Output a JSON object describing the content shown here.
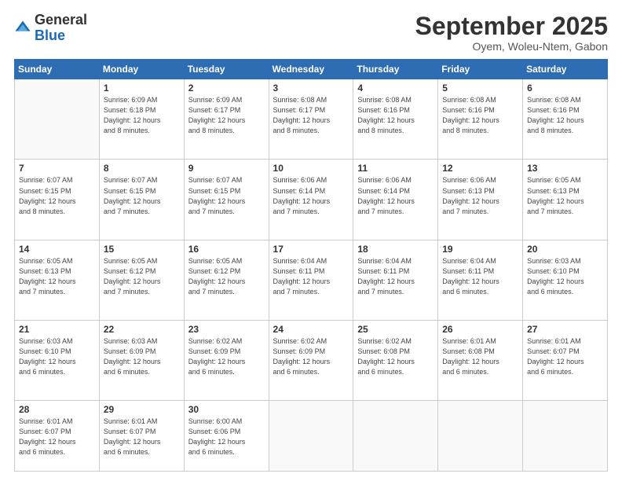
{
  "header": {
    "logo_general": "General",
    "logo_blue": "Blue",
    "month": "September 2025",
    "location": "Oyem, Woleu-Ntem, Gabon"
  },
  "weekdays": [
    "Sunday",
    "Monday",
    "Tuesday",
    "Wednesday",
    "Thursday",
    "Friday",
    "Saturday"
  ],
  "weeks": [
    [
      {
        "day": "",
        "info": ""
      },
      {
        "day": "1",
        "info": "Sunrise: 6:09 AM\nSunset: 6:18 PM\nDaylight: 12 hours\nand 8 minutes."
      },
      {
        "day": "2",
        "info": "Sunrise: 6:09 AM\nSunset: 6:17 PM\nDaylight: 12 hours\nand 8 minutes."
      },
      {
        "day": "3",
        "info": "Sunrise: 6:08 AM\nSunset: 6:17 PM\nDaylight: 12 hours\nand 8 minutes."
      },
      {
        "day": "4",
        "info": "Sunrise: 6:08 AM\nSunset: 6:16 PM\nDaylight: 12 hours\nand 8 minutes."
      },
      {
        "day": "5",
        "info": "Sunrise: 6:08 AM\nSunset: 6:16 PM\nDaylight: 12 hours\nand 8 minutes."
      },
      {
        "day": "6",
        "info": "Sunrise: 6:08 AM\nSunset: 6:16 PM\nDaylight: 12 hours\nand 8 minutes."
      }
    ],
    [
      {
        "day": "7",
        "info": "Sunrise: 6:07 AM\nSunset: 6:15 PM\nDaylight: 12 hours\nand 8 minutes."
      },
      {
        "day": "8",
        "info": "Sunrise: 6:07 AM\nSunset: 6:15 PM\nDaylight: 12 hours\nand 7 minutes."
      },
      {
        "day": "9",
        "info": "Sunrise: 6:07 AM\nSunset: 6:15 PM\nDaylight: 12 hours\nand 7 minutes."
      },
      {
        "day": "10",
        "info": "Sunrise: 6:06 AM\nSunset: 6:14 PM\nDaylight: 12 hours\nand 7 minutes."
      },
      {
        "day": "11",
        "info": "Sunrise: 6:06 AM\nSunset: 6:14 PM\nDaylight: 12 hours\nand 7 minutes."
      },
      {
        "day": "12",
        "info": "Sunrise: 6:06 AM\nSunset: 6:13 PM\nDaylight: 12 hours\nand 7 minutes."
      },
      {
        "day": "13",
        "info": "Sunrise: 6:05 AM\nSunset: 6:13 PM\nDaylight: 12 hours\nand 7 minutes."
      }
    ],
    [
      {
        "day": "14",
        "info": "Sunrise: 6:05 AM\nSunset: 6:13 PM\nDaylight: 12 hours\nand 7 minutes."
      },
      {
        "day": "15",
        "info": "Sunrise: 6:05 AM\nSunset: 6:12 PM\nDaylight: 12 hours\nand 7 minutes."
      },
      {
        "day": "16",
        "info": "Sunrise: 6:05 AM\nSunset: 6:12 PM\nDaylight: 12 hours\nand 7 minutes."
      },
      {
        "day": "17",
        "info": "Sunrise: 6:04 AM\nSunset: 6:11 PM\nDaylight: 12 hours\nand 7 minutes."
      },
      {
        "day": "18",
        "info": "Sunrise: 6:04 AM\nSunset: 6:11 PM\nDaylight: 12 hours\nand 7 minutes."
      },
      {
        "day": "19",
        "info": "Sunrise: 6:04 AM\nSunset: 6:11 PM\nDaylight: 12 hours\nand 6 minutes."
      },
      {
        "day": "20",
        "info": "Sunrise: 6:03 AM\nSunset: 6:10 PM\nDaylight: 12 hours\nand 6 minutes."
      }
    ],
    [
      {
        "day": "21",
        "info": "Sunrise: 6:03 AM\nSunset: 6:10 PM\nDaylight: 12 hours\nand 6 minutes."
      },
      {
        "day": "22",
        "info": "Sunrise: 6:03 AM\nSunset: 6:09 PM\nDaylight: 12 hours\nand 6 minutes."
      },
      {
        "day": "23",
        "info": "Sunrise: 6:02 AM\nSunset: 6:09 PM\nDaylight: 12 hours\nand 6 minutes."
      },
      {
        "day": "24",
        "info": "Sunrise: 6:02 AM\nSunset: 6:09 PM\nDaylight: 12 hours\nand 6 minutes."
      },
      {
        "day": "25",
        "info": "Sunrise: 6:02 AM\nSunset: 6:08 PM\nDaylight: 12 hours\nand 6 minutes."
      },
      {
        "day": "26",
        "info": "Sunrise: 6:01 AM\nSunset: 6:08 PM\nDaylight: 12 hours\nand 6 minutes."
      },
      {
        "day": "27",
        "info": "Sunrise: 6:01 AM\nSunset: 6:07 PM\nDaylight: 12 hours\nand 6 minutes."
      }
    ],
    [
      {
        "day": "28",
        "info": "Sunrise: 6:01 AM\nSunset: 6:07 PM\nDaylight: 12 hours\nand 6 minutes."
      },
      {
        "day": "29",
        "info": "Sunrise: 6:01 AM\nSunset: 6:07 PM\nDaylight: 12 hours\nand 6 minutes."
      },
      {
        "day": "30",
        "info": "Sunrise: 6:00 AM\nSunset: 6:06 PM\nDaylight: 12 hours\nand 6 minutes."
      },
      {
        "day": "",
        "info": ""
      },
      {
        "day": "",
        "info": ""
      },
      {
        "day": "",
        "info": ""
      },
      {
        "day": "",
        "info": ""
      }
    ]
  ]
}
